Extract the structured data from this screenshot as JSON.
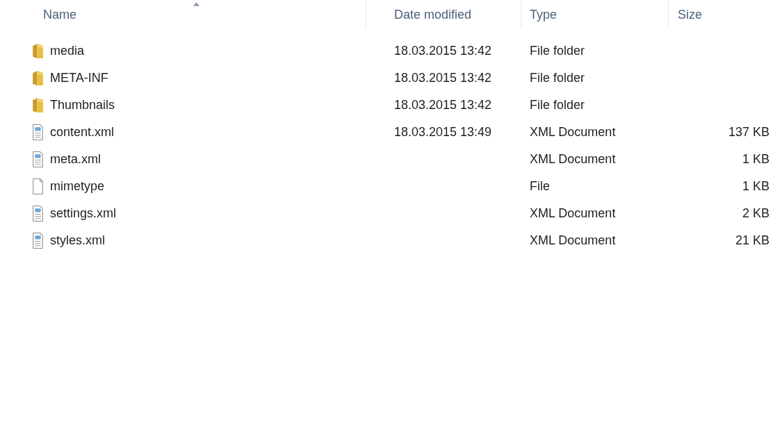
{
  "columns": [
    {
      "label": "Name",
      "sorted": true
    },
    {
      "label": "Date modified",
      "sorted": false
    },
    {
      "label": "Type",
      "sorted": false
    },
    {
      "label": "Size",
      "sorted": false
    }
  ],
  "files": [
    {
      "kind": "folder",
      "name": "media",
      "date": "18.03.2015 13:42",
      "type": "File folder"
    },
    {
      "kind": "folder",
      "name": "META-INF",
      "date": "18.03.2015 13:42",
      "type": "File folder"
    },
    {
      "kind": "folder",
      "name": "Thumbnails",
      "date": "18.03.2015 13:42",
      "type": "File folder"
    },
    {
      "kind": "xml",
      "name": "content.xml",
      "date": "18.03.2015 13:49",
      "type": "XML Document",
      "size": "137 KB"
    },
    {
      "kind": "xml",
      "name": "meta.xml",
      "type": "XML Document",
      "size": "1 KB"
    },
    {
      "kind": "file",
      "name": "mimetype",
      "type": "File",
      "size": "1 KB"
    },
    {
      "kind": "xml",
      "name": "settings.xml",
      "type": "XML Document",
      "size": "2 KB"
    },
    {
      "kind": "xml",
      "name": "styles.xml",
      "type": "XML Document",
      "size": "21 KB"
    }
  ]
}
